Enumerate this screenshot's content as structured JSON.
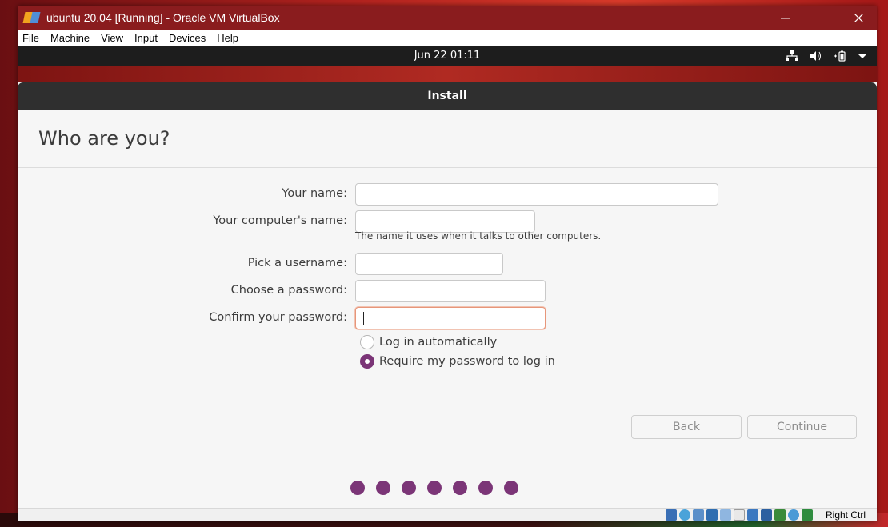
{
  "window": {
    "title": "ubuntu 20.04 [Running] - Oracle VM VirtualBox",
    "controls": [
      "minimize-icon",
      "maximize-icon",
      "close-icon"
    ]
  },
  "menubar": {
    "items": [
      "File",
      "Machine",
      "View",
      "Input",
      "Devices",
      "Help"
    ]
  },
  "topbar": {
    "clock": "Jun 22  01:11",
    "tray_icons": [
      "network-icon",
      "volume-icon",
      "battery-icon",
      "chevron-down-icon"
    ]
  },
  "installer": {
    "header_title": "Install",
    "page_title": "Who are you?",
    "fields": {
      "your_name": {
        "label": "Your name:",
        "value": ""
      },
      "computer_name": {
        "label": "Your computer's name:",
        "value": "",
        "hint": "The name it uses when it talks to other computers."
      },
      "username": {
        "label": "Pick a username:",
        "value": ""
      },
      "password": {
        "label": "Choose a password:",
        "value": ""
      },
      "confirm_password": {
        "label": "Confirm your password:",
        "value": ""
      }
    },
    "login_options": {
      "auto_login": {
        "label": "Log in automatically",
        "selected": false
      },
      "require_password": {
        "label": "Require my password to log in",
        "selected": true
      }
    },
    "buttons": {
      "back": "Back",
      "continue": "Continue"
    },
    "progress": {
      "total_steps": 7
    },
    "colors": {
      "accent": "#7b3577",
      "header": "#2f2f2f",
      "focus_border": "#e7967a"
    }
  },
  "statusbar": {
    "host_key": "Right Ctrl",
    "icons": [
      "hard-disk-icon",
      "optical-drive-icon",
      "audio-icon",
      "network-adapter-icon",
      "usb-icon",
      "shared-folders-icon",
      "display-icon",
      "video-capture-icon",
      "cpu-icon",
      "mouse-integration-icon",
      "keyboard-icon"
    ]
  }
}
